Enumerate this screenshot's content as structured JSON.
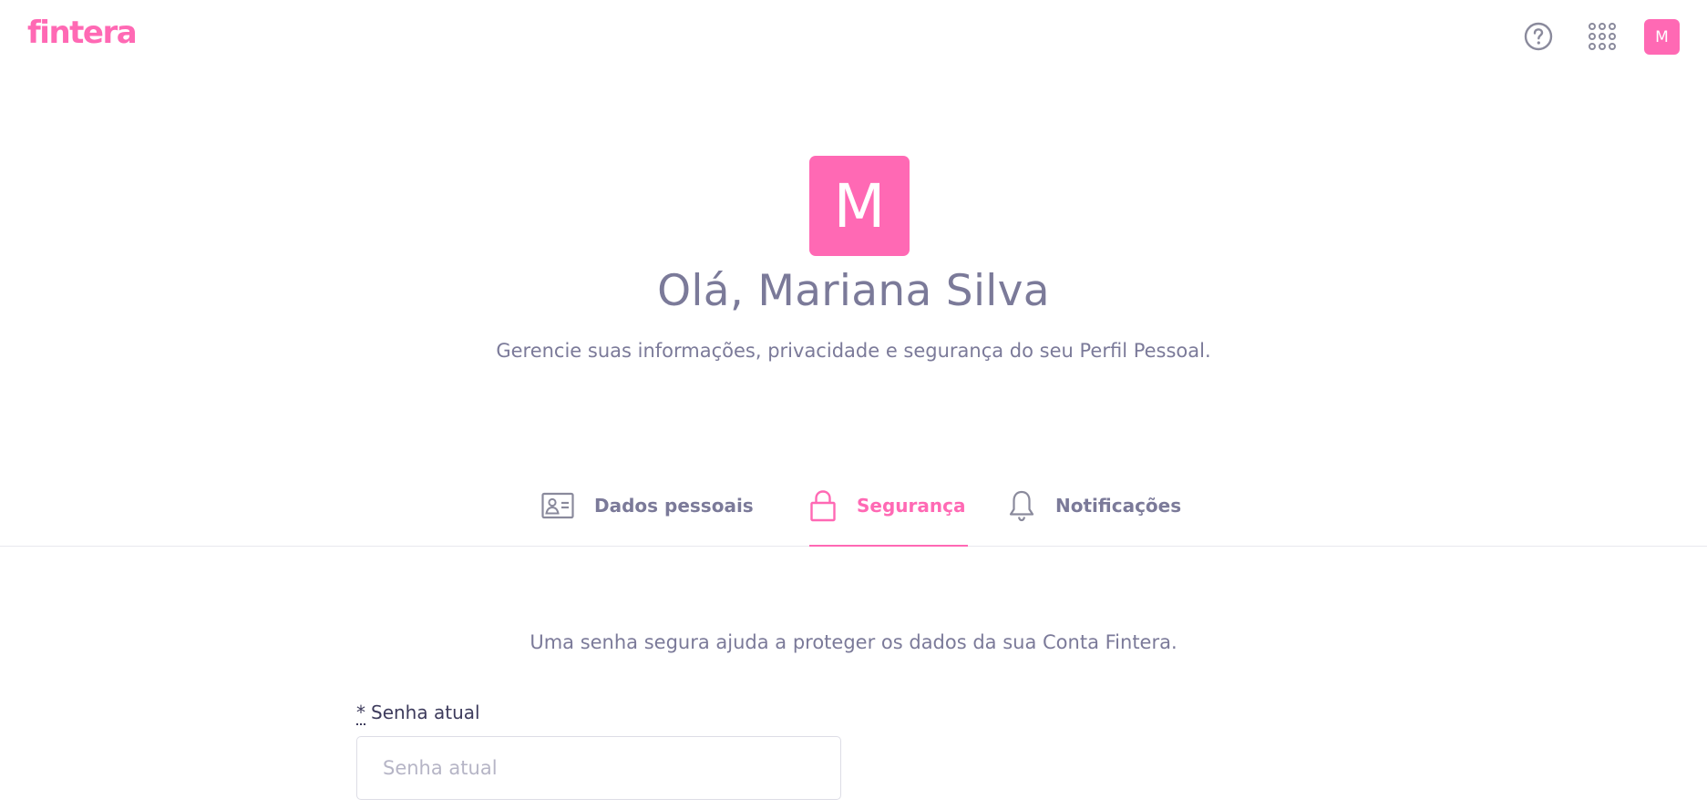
{
  "app": {
    "logo_text": "fintera",
    "brand_color": "#ff69b4"
  },
  "topbar": {
    "help_icon": "help-circle-icon",
    "apps_icon": "apps-grid-icon",
    "avatar_initial": "M"
  },
  "profile": {
    "avatar_initial": "M",
    "greeting": "Olá, Mariana Silva",
    "subtitle": "Gerencie suas informações, privacidade e segurança do seu Perfil Pessoal."
  },
  "tabs": [
    {
      "label": "Dados pessoais",
      "icon": "id-card-icon",
      "active": false
    },
    {
      "label": "Segurança",
      "icon": "lock-icon",
      "active": true
    },
    {
      "label": "Notificações",
      "icon": "bell-icon",
      "active": false
    }
  ],
  "security": {
    "intro": "Uma senha segura ajuda a proteger os dados da sua Conta Fintera.",
    "current_password": {
      "required_marker": "*",
      "label": "Senha atual",
      "placeholder": "Senha atual",
      "value": ""
    }
  }
}
